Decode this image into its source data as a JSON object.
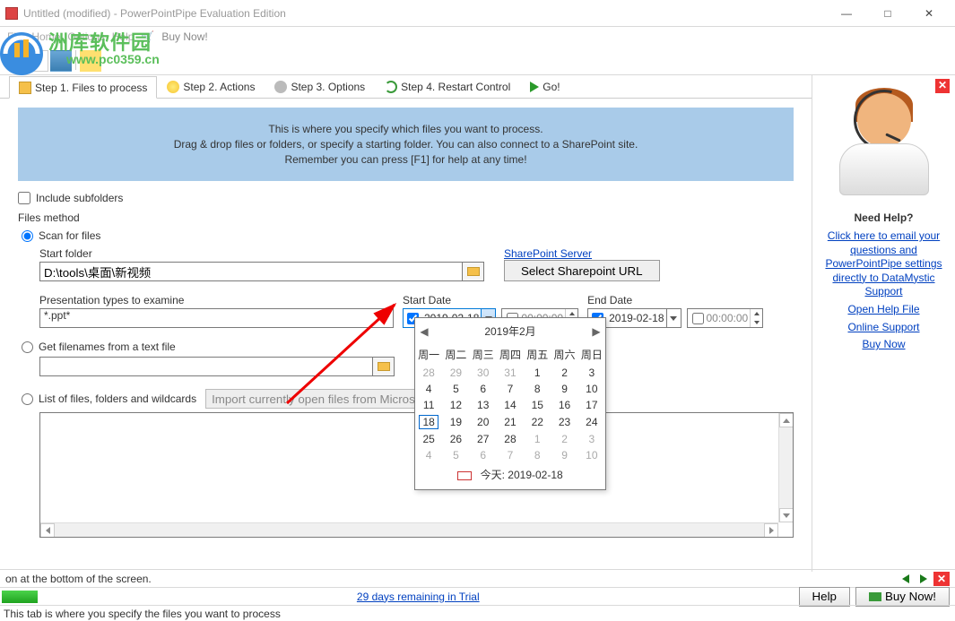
{
  "window": {
    "title": "Untitled (modified) - PowerPointPipe Evaluation Edition"
  },
  "winbtns": {
    "min": "—",
    "max": "□",
    "close": "✕"
  },
  "menu": {
    "file": "File",
    "home": "Home",
    "options": "Options",
    "help": "Help",
    "buy": "Buy Now!"
  },
  "watermark": {
    "text": "洲库软件园",
    "url": "www.pc0359.cn"
  },
  "tabs": {
    "t1": "Step 1. Files to process",
    "t2": "Step 2. Actions",
    "t3": "Step 3. Options",
    "t4": "Step 4. Restart Control",
    "go": "Go!"
  },
  "banner": {
    "l1": "This is where you specify which files you want to process.",
    "l2": "Drag & drop files or folders, or specify a starting folder. You can also connect to a SharePoint site.",
    "l3": "Remember you can press [F1] for help at any time!"
  },
  "opts": {
    "subfolders": "Include subfolders",
    "filesmethod": "Files method",
    "scan": "Scan for files",
    "startfolder": "Start folder",
    "folderpath": "D:\\tools\\桌面\\新视频",
    "sharepoint": "SharePoint Server",
    "selectsp": "Select Sharepoint URL",
    "ptypes": "Presentation types to examine",
    "ptypeval": "*.ppt*",
    "startdate": "Start Date",
    "enddate": "End Date",
    "dateval": "2019-02-18",
    "timeval": "00:00:00",
    "gettext": "Get filenames from a text file",
    "listfiles": "List of files, folders and wildcards",
    "importbtn": "Import currently open files from Microsoft"
  },
  "calendar": {
    "title": "2019年2月",
    "dow": [
      "周一",
      "周二",
      "周三",
      "周四",
      "周五",
      "周六",
      "周日"
    ],
    "weeks": [
      [
        {
          "d": "28",
          "o": true
        },
        {
          "d": "29",
          "o": true
        },
        {
          "d": "30",
          "o": true
        },
        {
          "d": "31",
          "o": true
        },
        {
          "d": "1"
        },
        {
          "d": "2"
        },
        {
          "d": "3"
        }
      ],
      [
        {
          "d": "4"
        },
        {
          "d": "5"
        },
        {
          "d": "6"
        },
        {
          "d": "7"
        },
        {
          "d": "8"
        },
        {
          "d": "9"
        },
        {
          "d": "10"
        }
      ],
      [
        {
          "d": "11"
        },
        {
          "d": "12"
        },
        {
          "d": "13"
        },
        {
          "d": "14"
        },
        {
          "d": "15"
        },
        {
          "d": "16"
        },
        {
          "d": "17"
        }
      ],
      [
        {
          "d": "18",
          "t": true
        },
        {
          "d": "19"
        },
        {
          "d": "20"
        },
        {
          "d": "21"
        },
        {
          "d": "22"
        },
        {
          "d": "23"
        },
        {
          "d": "24"
        }
      ],
      [
        {
          "d": "25"
        },
        {
          "d": "26"
        },
        {
          "d": "27"
        },
        {
          "d": "28"
        },
        {
          "d": "1",
          "o": true
        },
        {
          "d": "2",
          "o": true
        },
        {
          "d": "3",
          "o": true
        }
      ],
      [
        {
          "d": "4",
          "o": true
        },
        {
          "d": "5",
          "o": true
        },
        {
          "d": "6",
          "o": true
        },
        {
          "d": "7",
          "o": true
        },
        {
          "d": "8",
          "o": true
        },
        {
          "d": "9",
          "o": true
        },
        {
          "d": "10",
          "o": true
        }
      ]
    ],
    "today": "今天: 2019-02-18"
  },
  "help": {
    "title": "Need Help?",
    "email": "Click here to email your questions and PowerPointPipe settings directly to DataMystic Support",
    "openhelp": "Open Help File",
    "online": "Online Support",
    "buy": "Buy Now"
  },
  "status": {
    "msg": "on at the bottom of the screen.",
    "trial": "29 days remaining in Trial",
    "helpbtn": "Help",
    "buybtn": "Buy Now!"
  },
  "hint": "This tab is where you specify the files you want to process"
}
